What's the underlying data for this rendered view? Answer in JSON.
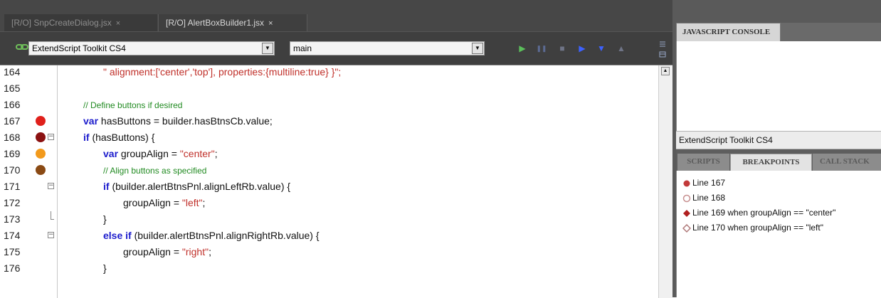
{
  "tabs": [
    {
      "label": "[R/O] SnpCreateDialog.jsx",
      "close": "×",
      "active": false
    },
    {
      "label": "[R/O] AlertBoxBuilder1.jsx",
      "close": "×",
      "active": true
    }
  ],
  "toolbar": {
    "target_value": "ExtendScript Toolkit CS4",
    "engine_value": "main",
    "dropdown_arrow": "▼",
    "buttons": {
      "run": "▶",
      "pause": "❚❚",
      "stop": "■",
      "step_over": "▶",
      "step_into": "▼",
      "step_out": "▲"
    },
    "colors": {
      "run": "#5bbf5b",
      "pause": "#5c6b94",
      "stop": "#6f7486",
      "step": "#3d62ff",
      "step_out": "#6f7486"
    }
  },
  "code": {
    "lines": [
      {
        "num": "164",
        "bp": null,
        "fold": null,
        "indent": 2,
        "tokens": [
          {
            "t": "\" alignment:['center','top'], properties:{multiline:true} }\";",
            "c": "str"
          }
        ]
      },
      {
        "num": "165",
        "bp": null,
        "fold": null,
        "indent": 0,
        "tokens": []
      },
      {
        "num": "166",
        "bp": null,
        "fold": null,
        "indent": 1,
        "tokens": [
          {
            "t": "// Define buttons if desired",
            "c": "cmt"
          }
        ]
      },
      {
        "num": "167",
        "bp": "red",
        "fold": null,
        "indent": 1,
        "tokens": [
          {
            "t": "var",
            "c": "kw"
          },
          {
            "t": " hasButtons = builder.hasBtnsCb.value;",
            "c": ""
          }
        ]
      },
      {
        "num": "168",
        "bp": "darkred",
        "fold": "open",
        "indent": 1,
        "tokens": [
          {
            "t": "if",
            "c": "kw"
          },
          {
            "t": " (hasButtons) {",
            "c": ""
          }
        ]
      },
      {
        "num": "169",
        "bp": "orange",
        "fold": null,
        "indent": 2,
        "tokens": [
          {
            "t": "var",
            "c": "kw"
          },
          {
            "t": " groupAlign = ",
            "c": ""
          },
          {
            "t": "\"center\"",
            "c": "str"
          },
          {
            "t": ";",
            "c": ""
          }
        ]
      },
      {
        "num": "170",
        "bp": "brown",
        "fold": null,
        "indent": 2,
        "tokens": [
          {
            "t": "// Align buttons as specified",
            "c": "cmt"
          }
        ]
      },
      {
        "num": "171",
        "bp": null,
        "fold": "open",
        "indent": 2,
        "tokens": [
          {
            "t": "if",
            "c": "kw"
          },
          {
            "t": " (builder.alertBtnsPnl.alignLeftRb.value) {",
            "c": ""
          }
        ]
      },
      {
        "num": "172",
        "bp": null,
        "fold": null,
        "indent": 3,
        "tokens": [
          {
            "t": "groupAlign = ",
            "c": ""
          },
          {
            "t": "\"left\"",
            "c": "str"
          },
          {
            "t": ";",
            "c": ""
          }
        ]
      },
      {
        "num": "173",
        "bp": null,
        "fold": "end",
        "indent": 2,
        "tokens": [
          {
            "t": "}",
            "c": ""
          }
        ]
      },
      {
        "num": "174",
        "bp": null,
        "fold": "open",
        "indent": 2,
        "tokens": [
          {
            "t": "else if",
            "c": "kw"
          },
          {
            "t": " (builder.alertBtnsPnl.alignRightRb.value) {",
            "c": ""
          }
        ]
      },
      {
        "num": "175",
        "bp": null,
        "fold": null,
        "indent": 3,
        "tokens": [
          {
            "t": "groupAlign = ",
            "c": ""
          },
          {
            "t": "\"right\"",
            "c": "str"
          },
          {
            "t": ";",
            "c": ""
          }
        ]
      },
      {
        "num": "176",
        "bp": null,
        "fold": null,
        "indent": 2,
        "tokens": [
          {
            "t": "}",
            "c": ""
          }
        ]
      }
    ],
    "colors": {
      "red": "#e0201b",
      "darkred": "#8b1111",
      "orange": "#f29a1d",
      "brown": "#8a4a14"
    }
  },
  "console": {
    "tab_label": "JAVASCRIPT CONSOLE"
  },
  "target_label": "ExtendScript Toolkit CS4",
  "lower_tabs": {
    "scripts": "SCRIPTS",
    "breakpoints": "BREAKPOINTS",
    "callstack": "CALL STACK"
  },
  "breakpoints": [
    {
      "label": "Line 167",
      "icon": "circle-filled",
      "color": "#c23a3a"
    },
    {
      "label": "Line 168",
      "icon": "circle-hollow",
      "color": "#c79090"
    },
    {
      "label": "Line 169 when groupAlign == \"center\"",
      "icon": "diamond-filled",
      "color": "#b02020"
    },
    {
      "label": "Line 170 when groupAlign == \"left\"",
      "icon": "diamond-hollow",
      "color": "#b07a7a"
    }
  ]
}
